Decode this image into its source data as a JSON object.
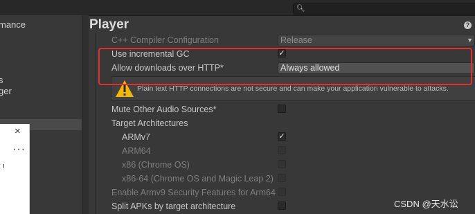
{
  "sidebar": {
    "partial_items": [
      "mance",
      "s",
      "ger"
    ]
  },
  "popup": {
    "close_glyph": "×",
    "more_glyph": "···"
  },
  "inspector": {
    "title": "Player",
    "rows": [
      {
        "label": "C++ Compiler Configuration",
        "type": "dropdown",
        "value": "Release",
        "dim": true
      },
      {
        "label": "Use incremental GC",
        "type": "checkbox",
        "checked": true
      },
      {
        "label": "Allow downloads over HTTP*",
        "type": "dropdown",
        "value": "Always allowed"
      },
      {
        "label": "Mute Other Audio Sources*",
        "type": "checkbox",
        "checked": false
      },
      {
        "label": "Target Architectures",
        "type": "header"
      },
      {
        "label": "ARMv7",
        "type": "checkbox",
        "checked": true
      },
      {
        "label": "ARM64",
        "type": "checkbox",
        "checked": false,
        "dim": true
      },
      {
        "label": "x86 (Chrome OS)",
        "type": "checkbox",
        "checked": false,
        "dim": true
      },
      {
        "label": "x86-64 (Chrome OS and Magic Leap 2)",
        "type": "checkbox",
        "checked": false,
        "dim": true
      },
      {
        "label": "Enable Armv9 Security Features for Arm64",
        "type": "checkbox",
        "checked": false,
        "dim": true
      },
      {
        "label": "Split APKs by target architecture",
        "type": "checkbox",
        "checked": false
      }
    ],
    "warning": "Plain text HTTP connections are not secure and can make your application vulnerable to attacks.",
    "check_glyph": "✓"
  },
  "watermark": "CSDN @天水讼",
  "colors": {
    "highlight": "#e3302a",
    "warning_yellow": "#f2b705"
  },
  "icons": [
    "search-icon",
    "help-icon",
    "warning-icon",
    "close-icon",
    "more-icon"
  ]
}
